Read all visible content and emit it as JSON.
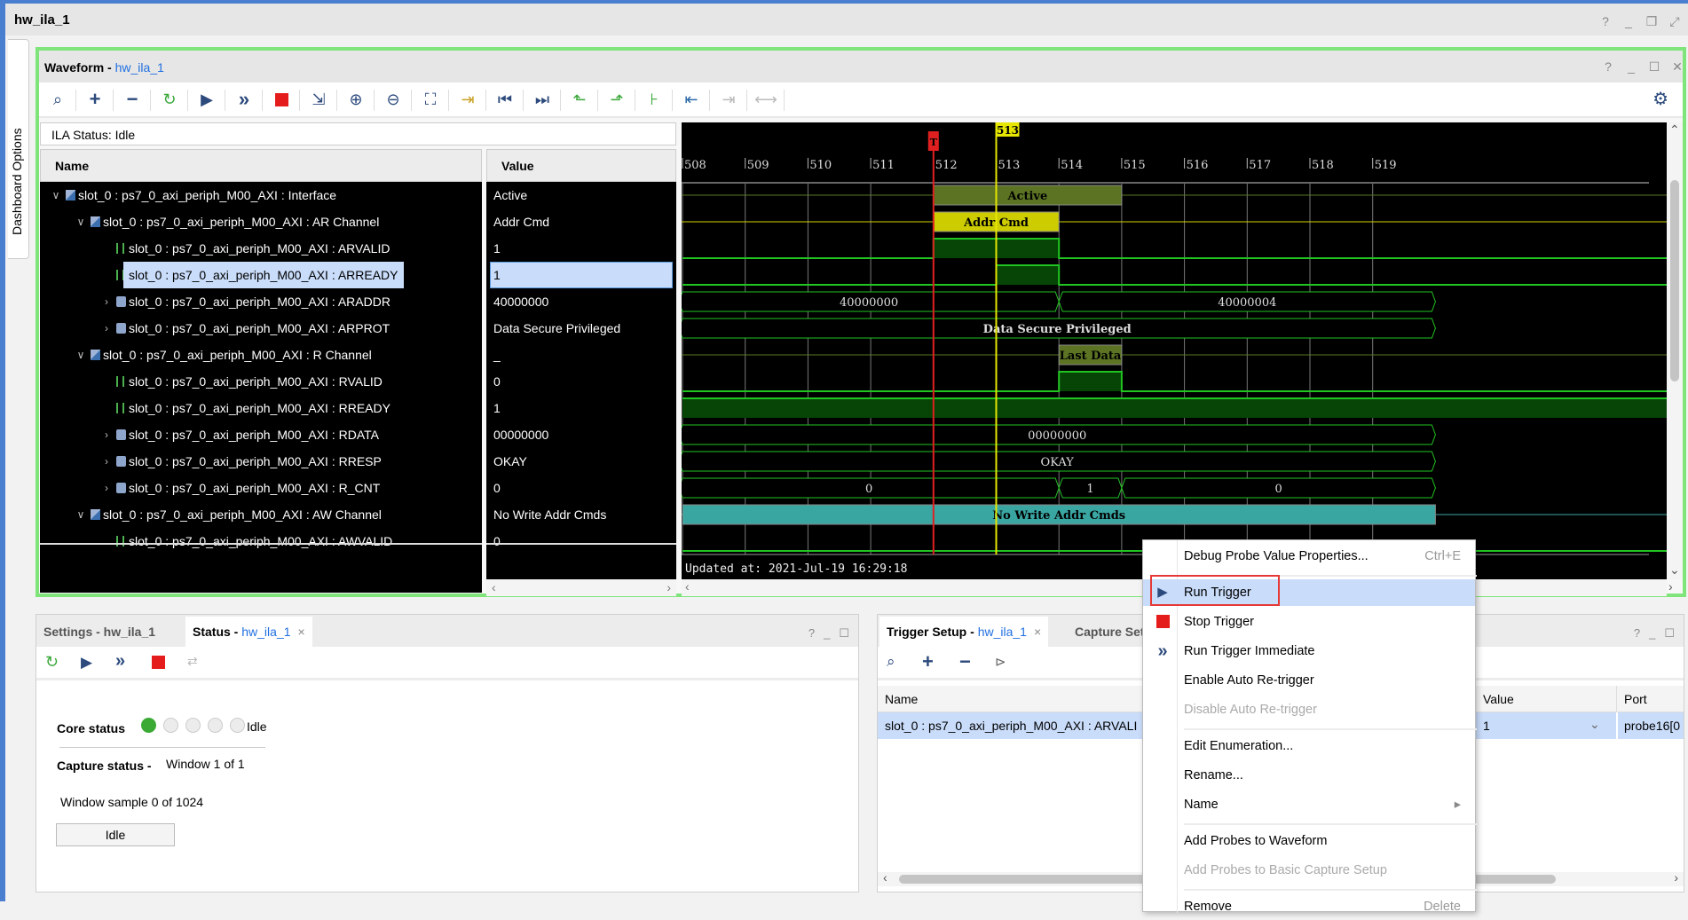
{
  "window": {
    "title": "hw_ila_1",
    "controls": [
      "?",
      "minimize",
      "restore",
      "maximize",
      "close"
    ]
  },
  "dashboard_tab": {
    "label": "Dashboard Options"
  },
  "waveform": {
    "title": "Waveform",
    "link": "hw_ila_1",
    "controls": [
      "?",
      "minimize",
      "maximize",
      "close"
    ],
    "toolbar": [
      {
        "name": "search",
        "icon": "magnifier-icon"
      },
      {
        "name": "add",
        "icon": "plus-icon"
      },
      {
        "name": "remove",
        "icon": "minus-icon"
      },
      {
        "name": "auto-retrigger",
        "icon": "retrigger-icon"
      },
      {
        "name": "run-trigger",
        "icon": "play-icon"
      },
      {
        "name": "run-trigger-immediate",
        "icon": "double-chevron-icon"
      },
      {
        "name": "stop-trigger",
        "icon": "stop-icon"
      },
      {
        "name": "export",
        "icon": "export-icon"
      },
      {
        "name": "zoom-in",
        "icon": "zoom-in-icon"
      },
      {
        "name": "zoom-out",
        "icon": "zoom-out-icon"
      },
      {
        "name": "zoom-fit",
        "icon": "zoom-fit-icon"
      },
      {
        "name": "go-to-cursor",
        "icon": "goto-cursor-icon"
      },
      {
        "name": "go-to-time-zero",
        "icon": "first-icon"
      },
      {
        "name": "go-to-last-time",
        "icon": "last-icon"
      },
      {
        "name": "previous-transition",
        "icon": "prev-transition-icon"
      },
      {
        "name": "next-transition",
        "icon": "next-transition-icon"
      },
      {
        "name": "add-marker",
        "icon": "add-marker-icon"
      },
      {
        "name": "previous-marker",
        "icon": "prev-marker-icon"
      },
      {
        "name": "next-marker",
        "icon": "next-marker-icon",
        "disabled": true
      },
      {
        "name": "swap-cursors",
        "icon": "swap-cursors-icon",
        "disabled": true
      }
    ],
    "ila_status": "ILA Status:  Idle",
    "columns": {
      "name": "Name",
      "value": "Value"
    },
    "rows": [
      {
        "name": "slot_0 : ps7_0_axi_periph_M00_AXI : Interface",
        "value": "Active",
        "level": 0,
        "expander": "open",
        "kind": "group"
      },
      {
        "name": "slot_0 : ps7_0_axi_periph_M00_AXI : AR Channel",
        "value": "Addr Cmd",
        "level": 1,
        "expander": "open",
        "kind": "group"
      },
      {
        "name": "slot_0 : ps7_0_axi_periph_M00_AXI : ARVALID",
        "value": "1",
        "level": 2,
        "expander": "none",
        "kind": "bit"
      },
      {
        "name": "slot_0 : ps7_0_axi_periph_M00_AXI : ARREADY",
        "value": "1",
        "level": 2,
        "expander": "none",
        "kind": "bit",
        "selected": true
      },
      {
        "name": "slot_0 : ps7_0_axi_periph_M00_AXI : ARADDR",
        "value": "40000000",
        "level": 2,
        "expander": "closed",
        "kind": "bus"
      },
      {
        "name": "slot_0 : ps7_0_axi_periph_M00_AXI : ARPROT",
        "value": "Data Secure Privileged",
        "level": 2,
        "expander": "closed",
        "kind": "bus"
      },
      {
        "name": "slot_0 : ps7_0_axi_periph_M00_AXI : R Channel",
        "value": "_",
        "level": 1,
        "expander": "open",
        "kind": "group"
      },
      {
        "name": "slot_0 : ps7_0_axi_periph_M00_AXI : RVALID",
        "value": "0",
        "level": 2,
        "expander": "none",
        "kind": "bit"
      },
      {
        "name": "slot_0 : ps7_0_axi_periph_M00_AXI : RREADY",
        "value": "1",
        "level": 2,
        "expander": "none",
        "kind": "bit"
      },
      {
        "name": "slot_0 : ps7_0_axi_periph_M00_AXI : RDATA",
        "value": "00000000",
        "level": 2,
        "expander": "closed",
        "kind": "bus"
      },
      {
        "name": "slot_0 : ps7_0_axi_periph_M00_AXI : RRESP",
        "value": "OKAY",
        "level": 2,
        "expander": "closed",
        "kind": "bus"
      },
      {
        "name": "slot_0 : ps7_0_axi_periph_M00_AXI : R_CNT",
        "value": "0",
        "level": 2,
        "expander": "closed",
        "kind": "bus"
      },
      {
        "name": "slot_0 : ps7_0_axi_periph_M00_AXI : AW Channel",
        "value": "No Write Addr Cmds",
        "level": 1,
        "expander": "open",
        "kind": "group"
      },
      {
        "name": "slot_0 : ps7_0_axi_periph_M00_AXI : AWVALID",
        "value": "0",
        "level": 2,
        "expander": "none",
        "kind": "bit"
      }
    ],
    "timeline": {
      "ticks": [
        "508",
        "509",
        "510",
        "511",
        "512",
        "513",
        "514",
        "515",
        "516",
        "517",
        "518",
        "519"
      ],
      "tick_start": 508,
      "trigger_marker": {
        "label": "T",
        "at": 512,
        "color": "#e02020"
      },
      "cursor": {
        "label": "513",
        "at": 513,
        "color": "#e6e600"
      }
    },
    "traces": [
      {
        "type": "txn",
        "idle_color": "#5b7a22",
        "segments": [
          {
            "from": 512,
            "to": 515,
            "label": "Active",
            "fill": "#5b7323"
          }
        ]
      },
      {
        "type": "txn",
        "idle_color": "#d4d400",
        "segments": [
          {
            "from": 512,
            "to": 514,
            "label": "Addr Cmd",
            "fill": "#cccc00"
          }
        ]
      },
      {
        "type": "bit",
        "levels": [
          [
            508,
            0
          ],
          [
            512,
            1
          ],
          [
            514,
            0
          ]
        ]
      },
      {
        "type": "bit",
        "levels": [
          [
            508,
            0
          ],
          [
            513,
            1
          ],
          [
            514,
            0
          ]
        ]
      },
      {
        "type": "bus",
        "segments": [
          {
            "from": 508,
            "to": 514,
            "label": "40000000"
          },
          {
            "from": 514,
            "to": 520,
            "label": "40000004"
          }
        ]
      },
      {
        "type": "bus",
        "segments": [
          {
            "from": 508,
            "to": 520,
            "label": "Data Secure Privileged"
          }
        ]
      },
      {
        "type": "txn",
        "idle_color": "#5b7a22",
        "segments": [
          {
            "from": 514,
            "to": 515,
            "label": "Last Data",
            "fill": "#5b7323"
          }
        ]
      },
      {
        "type": "bit",
        "levels": [
          [
            508,
            0
          ],
          [
            514,
            1
          ],
          [
            515,
            0
          ]
        ]
      },
      {
        "type": "bit",
        "levels": [
          [
            508,
            1
          ]
        ]
      },
      {
        "type": "bus",
        "segments": [
          {
            "from": 508,
            "to": 520,
            "label": "00000000"
          }
        ]
      },
      {
        "type": "bus",
        "segments": [
          {
            "from": 508,
            "to": 520,
            "label": "OKAY"
          }
        ]
      },
      {
        "type": "bus",
        "segments": [
          {
            "from": 508,
            "to": 514,
            "label": "0"
          },
          {
            "from": 514,
            "to": 515,
            "label": "1"
          },
          {
            "from": 515,
            "to": 520,
            "label": "0"
          }
        ]
      },
      {
        "type": "txn",
        "idle_color": "#3aa6a2",
        "segments": [
          {
            "from": 508,
            "to": 520,
            "label": "No Write Addr Cmds",
            "fill": "#3aa6a2"
          }
        ]
      },
      {
        "type": "bit",
        "levels": [
          [
            508,
            0
          ]
        ]
      }
    ],
    "updated_at": "Updated at: 2021-Jul-19 16:29:18"
  },
  "status_panel": {
    "tabs": [
      {
        "label": "Settings - hw_ila_1",
        "active": false
      },
      {
        "title": "Status",
        "link": "hw_ila_1",
        "active": true,
        "closable": true
      }
    ],
    "dash": " - ",
    "controls": [
      "?",
      "minimize",
      "maximize"
    ],
    "toolbar": [
      "auto-retrigger-icon",
      "play-icon",
      "double-chevron-icon",
      "stop-icon",
      "swap-icon"
    ],
    "core_status_label": "Core status",
    "core_status_steps": 5,
    "core_status_active": 1,
    "core_status_text": "Idle",
    "capture_status_label": "Capture status -",
    "capture_status_value": "Window 1 of 1",
    "window_sample": "Window sample 0 of 1024",
    "progress_label": "Idle"
  },
  "trigger_panel": {
    "tabs": [
      {
        "title": "Trigger Setup",
        "link": "hw_ila_1",
        "active": true,
        "closable": true
      },
      {
        "label": "Capture Setu",
        "active": false
      }
    ],
    "controls": [
      "?",
      "minimize",
      "maximize"
    ],
    "toolbar": [
      "magnifier-icon",
      "plus-icon",
      "minus-icon",
      "logic-gate-icon"
    ],
    "columns": {
      "name": "Name",
      "value": "Value",
      "port": "Port"
    },
    "row": {
      "name": "slot_0 : ps7_0_axi_periph_M00_AXI : ARVALI",
      "value": "1",
      "port": "probe16[0"
    }
  },
  "context_menu": {
    "items": [
      {
        "label": "Debug Probe Value Properties...",
        "shortcut": "Ctrl+E"
      },
      {
        "sep": true
      },
      {
        "label": "Run Trigger",
        "icon": "play-icon",
        "highlighted": true,
        "annotated": true
      },
      {
        "label": "Stop Trigger",
        "icon": "stop-icon"
      },
      {
        "label": "Run Trigger Immediate",
        "icon": "double-chevron-icon"
      },
      {
        "label": "Enable Auto Re-trigger"
      },
      {
        "label": "Disable Auto Re-trigger",
        "disabled": true
      },
      {
        "sep": true
      },
      {
        "label": "Edit Enumeration..."
      },
      {
        "label": "Rename..."
      },
      {
        "label": "Name",
        "submenu": true
      },
      {
        "sep": true
      },
      {
        "label": "Add Probes to Waveform"
      },
      {
        "label": "Add Probes to Basic Capture Setup",
        "disabled": true
      },
      {
        "sep": true
      },
      {
        "label": "Remove",
        "shortcut": "Delete"
      }
    ]
  },
  "colors": {
    "frame_green": "#7fe57a",
    "accent_blue": "#1f6fe0",
    "highlight": "#c9dcfa",
    "annotation_red": "#e53935",
    "wave_green": "#22c422",
    "wave_fill": "#064506"
  }
}
